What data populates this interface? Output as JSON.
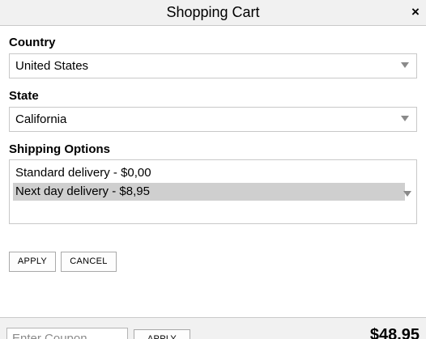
{
  "window": {
    "title": "Shopping Cart",
    "close_glyph": "×",
    "close_icon": "close-icon"
  },
  "country": {
    "label": "Country",
    "value": "United States",
    "icon": "chevron-down-icon"
  },
  "state": {
    "label": "State",
    "value": "California",
    "icon": "chevron-down-icon"
  },
  "shipping": {
    "label": "Shipping Options",
    "options": [
      {
        "label": "Standard delivery - $0,00",
        "selected": false
      },
      {
        "label": "Next day delivery - $8,95",
        "selected": true
      }
    ],
    "icon": "chevron-down-icon"
  },
  "actions": {
    "apply_label": "APPLY",
    "cancel_label": "CANCEL"
  },
  "footer": {
    "coupon_placeholder": "Enter Coupon",
    "coupon_value": "",
    "apply_label": "APPLY",
    "total": "$48.95"
  },
  "colors": {
    "titlebar_bg": "#f1f1f1",
    "selected_option_bg": "#cfcfcf",
    "border": "#c8c8c8"
  }
}
